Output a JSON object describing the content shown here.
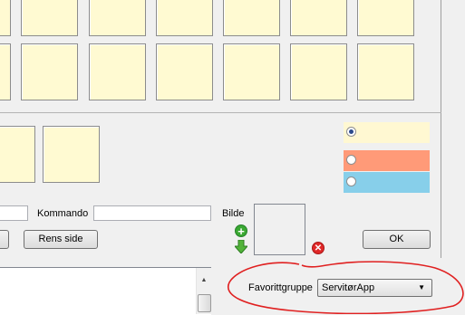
{
  "form": {
    "kommando_label": "Kommando",
    "kommando_value": "",
    "bilde_label": "Bilde",
    "clear_page_label": "Rens side",
    "ok_label": "OK",
    "favoritt_label": "Favorittgruppe",
    "favoritt_selected": "ServitørApp"
  },
  "colors": {
    "tile": "#fffad2",
    "option_yellow": "#fff8d2",
    "option_orange": "#ff9a78",
    "option_blue": "#87cfea",
    "highlight_ellipse": "#e02020"
  },
  "icons": {
    "add": "add-icon",
    "move_down": "arrow-down-icon",
    "delete": "delete-icon"
  }
}
